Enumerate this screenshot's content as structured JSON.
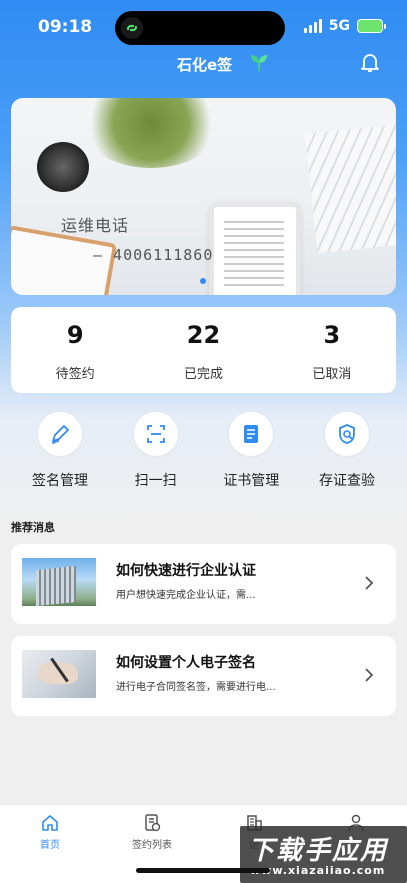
{
  "status_bar": {
    "time": "09:18",
    "network": "5G",
    "battery_color": "#6ee36e"
  },
  "header": {
    "title": "石化e签",
    "leaf_icon": "leaf-icon",
    "bell_icon": "bell-icon"
  },
  "banner": {
    "caption": "运维电话",
    "phone": "— 4006111860",
    "slide_indicator_active": 1
  },
  "stats": [
    {
      "value": "9",
      "label": "待签约"
    },
    {
      "value": "22",
      "label": "已完成"
    },
    {
      "value": "3",
      "label": "已取消"
    }
  ],
  "actions": [
    {
      "label": "签名管理",
      "icon": "pen-icon"
    },
    {
      "label": "扫一扫",
      "icon": "scan-icon"
    },
    {
      "label": "证书管理",
      "icon": "certificate-icon"
    },
    {
      "label": "存证查验",
      "icon": "shield-search-icon"
    }
  ],
  "recommend": {
    "title": "推荐消息",
    "items": [
      {
        "title": "如何快速进行企业认证",
        "desc": "用户想快速完成企业认证，需...",
        "thumb": "office-building"
      },
      {
        "title": "如何设置个人电子签名",
        "desc": "进行电子合同签名签，需要进行电...",
        "thumb": "hand-signing"
      }
    ]
  },
  "tabbar": [
    {
      "label": "首页",
      "icon": "home-icon",
      "active": true
    },
    {
      "label": "签约列表",
      "icon": "contract-list-icon",
      "active": false
    },
    {
      "label": "企",
      "icon": "company-icon",
      "active": false
    },
    {
      "label": "",
      "icon": "user-icon",
      "active": false
    }
  ],
  "watermark": {
    "main": "下载手应用",
    "sub": "www.xiazaiiao.com"
  },
  "colors": {
    "primary": "#2f8cf2",
    "background": "#efefef",
    "card": "#ffffff"
  }
}
